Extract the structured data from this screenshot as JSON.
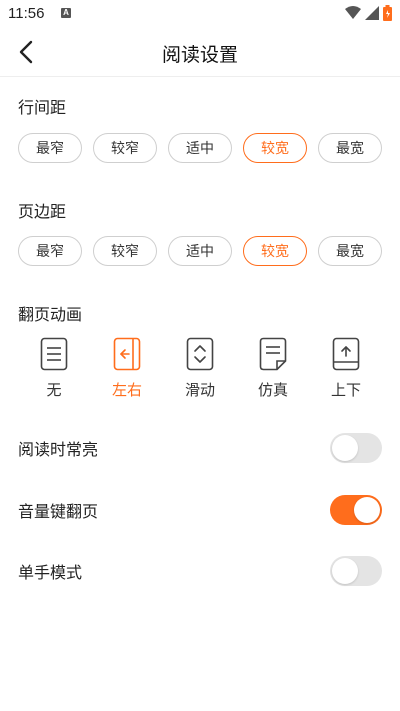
{
  "status_bar": {
    "time": "11:56",
    "notification_icon": "A",
    "icons": [
      "wifi-icon",
      "signal-icon",
      "battery-icon"
    ]
  },
  "header": {
    "title": "阅读设置",
    "back_icon": "chevron-left-icon"
  },
  "line_spacing": {
    "title": "行间距",
    "options": [
      "最窄",
      "较窄",
      "适中",
      "较宽",
      "最宽"
    ],
    "selected": "较宽"
  },
  "page_margin": {
    "title": "页边距",
    "options": [
      "最窄",
      "较窄",
      "适中",
      "较宽",
      "最宽"
    ],
    "selected": "较宽"
  },
  "page_animation": {
    "title": "翻页动画",
    "options": [
      {
        "label": "无",
        "icon": "page-lines-icon"
      },
      {
        "label": "左右",
        "icon": "page-left-right-icon"
      },
      {
        "label": "滑动",
        "icon": "page-slide-icon"
      },
      {
        "label": "仿真",
        "icon": "page-curl-icon"
      },
      {
        "label": "上下",
        "icon": "page-up-down-icon"
      }
    ],
    "selected": "左右"
  },
  "toggles": [
    {
      "label": "阅读时常亮",
      "on": false
    },
    {
      "label": "音量键翻页",
      "on": true
    },
    {
      "label": "单手模式",
      "on": false
    }
  ],
  "colors": {
    "accent": "#ff6d1c",
    "border": "#cfcfcf",
    "toggle_off": "#e4e4e4"
  }
}
